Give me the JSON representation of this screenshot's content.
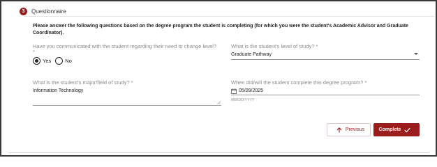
{
  "step": {
    "number": "3",
    "title": "Questionnaire"
  },
  "instructions": "Please answer the following questions based on the degree program the student is completing (for which you were the student's Academic Advisor and Graduate Coordinator).",
  "questions": {
    "communicated": {
      "label": "Have you communicated with the student regarding their need to change level?",
      "required_mark": "*",
      "options": [
        "Yes",
        "No"
      ],
      "selected": "Yes"
    },
    "level_of_study": {
      "label": "What is the student's level of study? *",
      "value": "Graduate Pathway"
    },
    "major": {
      "label": "What is the student's major/field of study? *",
      "value": "Information Technology"
    },
    "completion_date": {
      "label": "When did/will the student complete this degree program? *",
      "value": "05/09/2025",
      "format_hint": "MM/DD/YYYY"
    }
  },
  "actions": {
    "previous_label": "Previous",
    "complete_label": "Complete"
  },
  "colors": {
    "accent": "#9b1c1c",
    "border": "#3a3a3a"
  },
  "icons": {
    "step": "step-number-badge",
    "radio": "radio-button",
    "select": "chevron-down-icon",
    "date": "calendar-icon",
    "previous": "arrow-up-icon",
    "complete": "checkmark-icon",
    "textarea": "resize-grip-icon"
  }
}
